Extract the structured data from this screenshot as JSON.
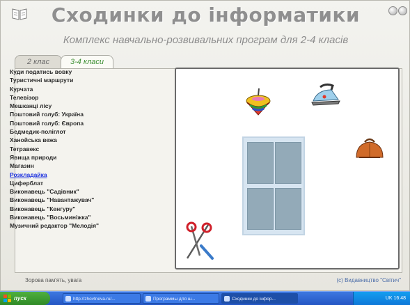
{
  "app": {
    "title": "Сходинки до інформатики",
    "subtitle": "Комплекс навчально-розвивальних програм для 2-4 класів"
  },
  "tabs": [
    {
      "label": "2 клас",
      "active": false
    },
    {
      "label": "3-4 класи",
      "active": true
    }
  ],
  "programs": [
    "Куди податись вовку",
    "Туристичні маршрути",
    "Курчата",
    "Телевізор",
    "Мешканці лісу",
    "Поштовий голуб: Україна",
    "Поштовий голуб: Європа",
    "Бедмедик-поліглот",
    "Ханойська вежа",
    "Тетравекс",
    "Явища природи",
    "Магазин",
    "Розкладайка",
    "Циферблат",
    "Виконавець \"Садівник\"",
    "Виконавець \"Навантажувач\"",
    "Виконавець \"Кенгуру\"",
    "Виконавець \"Восьминіжка\"",
    "Музичний редактор \"Мелодія\""
  ],
  "selected_program": "Розкладайка",
  "preview_objects": [
    "spinning-top",
    "iron",
    "handbag",
    "scissors",
    "window"
  ],
  "status": {
    "left": "Зорова пам'ять, увага",
    "right": "(c) Видавництво \"Світич\""
  },
  "taskbar": {
    "start_label": "пуск",
    "tasks": [
      {
        "label": "http://zhovtneva.ru/...",
        "active": false
      },
      {
        "label": "Программы для ш...",
        "active": false
      },
      {
        "label": "Сходинки до інфор...",
        "active": true
      }
    ],
    "tray_text": "UK  16:48"
  },
  "colors": {
    "title": "#8f8f8f",
    "selected_link": "#1a2fe0",
    "active_tab_text": "#3d8f33",
    "taskbar": "#2456c4",
    "start_button": "#3b9a2f"
  }
}
